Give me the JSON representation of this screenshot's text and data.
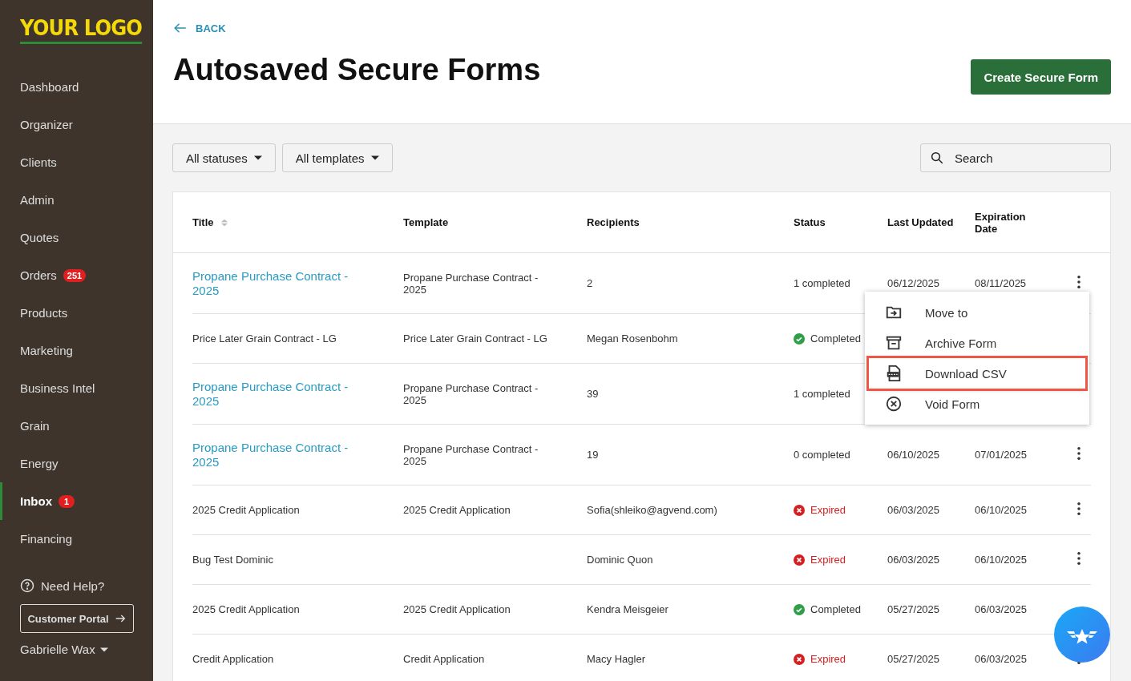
{
  "sidebar": {
    "logo": "YOUR LOGO",
    "items": [
      {
        "label": "Dashboard",
        "selected": false
      },
      {
        "label": "Organizer",
        "selected": false
      },
      {
        "label": "Clients",
        "selected": false
      },
      {
        "label": "Admin",
        "selected": false
      },
      {
        "label": "Quotes",
        "selected": false
      },
      {
        "label": "Orders",
        "badge": "251",
        "selected": false
      },
      {
        "label": "Products",
        "selected": false
      },
      {
        "label": "Marketing",
        "selected": false
      },
      {
        "label": "Business Intel",
        "selected": false
      },
      {
        "label": "Grain",
        "selected": false
      },
      {
        "label": "Energy",
        "selected": false
      },
      {
        "label": "Inbox",
        "badge": "1",
        "selected": true
      },
      {
        "label": "Financing",
        "selected": false
      }
    ],
    "help": "Need Help?",
    "portal_button": "Customer Portal",
    "user": "Gabrielle Wax"
  },
  "header": {
    "back": "BACK",
    "title": "Autosaved Secure Forms",
    "create_button": "Create Secure Form"
  },
  "filters": {
    "dropdowns": [
      "All statuses",
      "All templates"
    ],
    "search": {
      "placeholder": "Search"
    }
  },
  "table": {
    "columns": [
      "Title",
      "Template",
      "Recipients",
      "Status",
      "Last Updated",
      "Expiration Date"
    ],
    "rows": [
      {
        "title": {
          "text": "Propane Purchase Contract - 2025",
          "kind": "link"
        },
        "template": "Propane Purchase Contract - 2025",
        "recipients": "2",
        "status": {
          "text": "1 completed",
          "kind": "count"
        },
        "last_updated": "06/12/2025",
        "expiration": "08/11/2025",
        "menu_button": true
      },
      {
        "title": {
          "text": "Price Later Grain Contract - LG",
          "kind": "plain"
        },
        "template": "Price Later Grain Contract - LG",
        "recipients": "Megan Rosenbohm",
        "status": {
          "text": "Completed",
          "kind": "completed"
        },
        "menu_button": false
      },
      {
        "title": {
          "text": "Propane Purchase Contract - 2025",
          "kind": "link"
        },
        "template": "Propane Purchase Contract - 2025",
        "recipients": "39",
        "status": {
          "text": "1 completed",
          "kind": "count"
        },
        "menu_button": false
      },
      {
        "title": {
          "text": "Propane Purchase Contract - 2025",
          "kind": "link"
        },
        "template": "Propane Purchase Contract - 2025",
        "recipients": "19",
        "status": {
          "text": "0 completed",
          "kind": "count"
        },
        "last_updated": "06/10/2025",
        "expiration": "07/01/2025",
        "menu_button": true
      },
      {
        "title": {
          "text": "2025 Credit Application",
          "kind": "plain"
        },
        "template": "2025 Credit Application",
        "recipients": "Sofia(shleiko@agvend.com)",
        "status": {
          "text": "Expired",
          "kind": "expired"
        },
        "last_updated": "06/03/2025",
        "expiration": "06/10/2025",
        "menu_button": true
      },
      {
        "title": {
          "text": "Bug Test Dominic",
          "kind": "plain"
        },
        "recipients": "Dominic Quon",
        "status": {
          "text": "Expired",
          "kind": "expired"
        },
        "last_updated": "06/03/2025",
        "expiration": "06/10/2025",
        "menu_button": true
      },
      {
        "title": {
          "text": "2025 Credit Application",
          "kind": "plain"
        },
        "template": "2025 Credit Application",
        "recipients": "Kendra Meisgeier",
        "status": {
          "text": "Completed",
          "kind": "completed"
        },
        "last_updated": "05/27/2025",
        "expiration": "06/03/2025",
        "menu_button": false
      },
      {
        "title": {
          "text": "Credit Application",
          "kind": "plain"
        },
        "template": "Credit Application",
        "recipients": "Macy Hagler",
        "status": {
          "text": "Expired",
          "kind": "expired"
        },
        "last_updated": "05/27/2025",
        "expiration": "06/03/2025",
        "menu_button": true
      }
    ]
  },
  "context_menu": {
    "items": [
      {
        "label": "Move to",
        "kind": "move",
        "highlighted": false
      },
      {
        "label": "Archive Form",
        "kind": "archive",
        "highlighted": false
      },
      {
        "label": "Download CSV",
        "kind": "csv",
        "highlighted": true
      },
      {
        "label": "Void Form",
        "kind": "void",
        "highlighted": false
      }
    ]
  }
}
